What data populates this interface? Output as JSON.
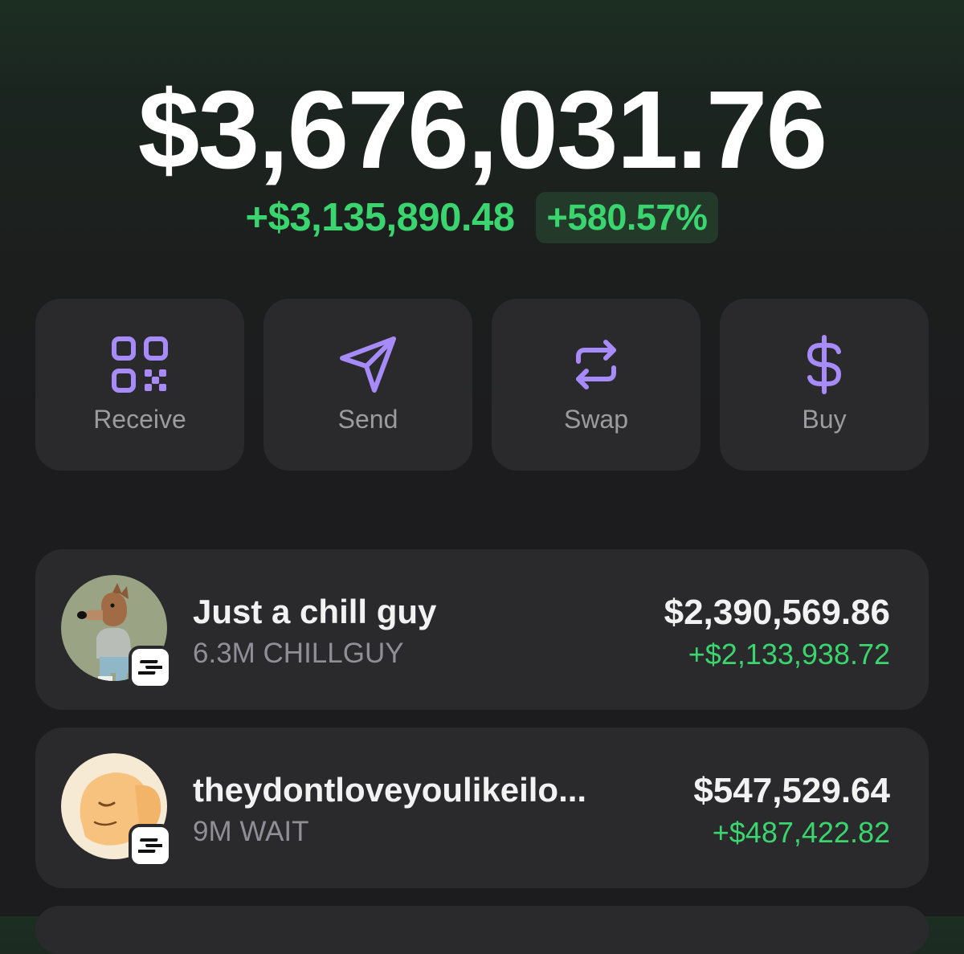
{
  "portfolio": {
    "balance": "$3,676,031.76",
    "change_amount": "+$3,135,890.48",
    "change_percent": "+580.57%"
  },
  "actions": [
    {
      "label": "Receive",
      "icon": "qr-code-icon"
    },
    {
      "label": "Send",
      "icon": "paper-plane-icon"
    },
    {
      "label": "Swap",
      "icon": "swap-arrows-icon"
    },
    {
      "label": "Buy",
      "icon": "dollar-icon"
    }
  ],
  "tokens": [
    {
      "name": "Just a chill guy",
      "quantity": "6.3M CHILLGUY",
      "value": "$2,390,569.86",
      "gain": "+$2,133,938.72",
      "avatar": "chill-guy-dog-avatar",
      "chain": "solana"
    },
    {
      "name": "theydontloveyoulikeilo...",
      "quantity": "9M WAIT",
      "value": "$547,529.64",
      "gain": "+$487,422.82",
      "avatar": "cartoon-elephant-avatar",
      "chain": "solana"
    }
  ],
  "colors": {
    "accent": "#a78bfa",
    "positive": "#3ad56e",
    "card": "#2a2a2c",
    "background": "#1c1c1e"
  }
}
